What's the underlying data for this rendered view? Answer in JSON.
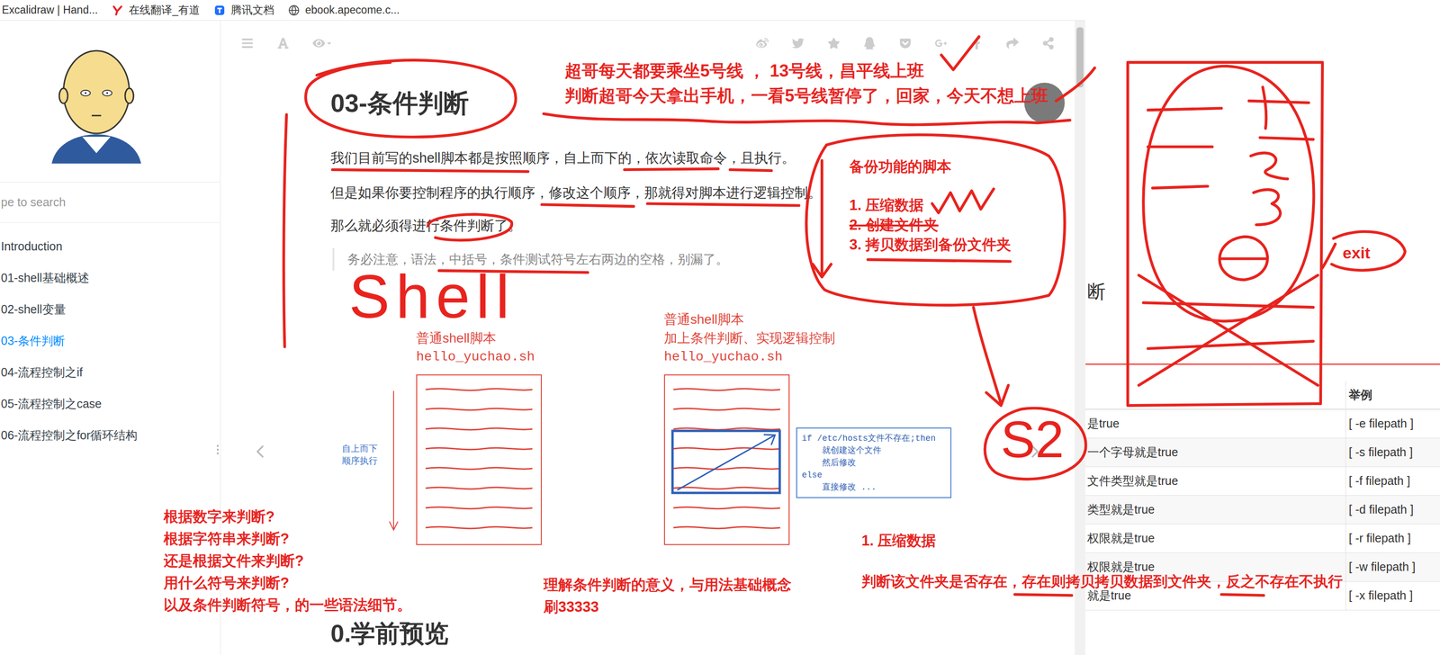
{
  "browser": {
    "bookmarks": [
      {
        "label": "Excalidraw | Hand...",
        "kind": "none"
      },
      {
        "label": "在线翻译_有道",
        "kind": "youdao"
      },
      {
        "label": "腾讯文档",
        "kind": "tencent"
      },
      {
        "label": "ebook.apecome.c...",
        "kind": "globe"
      }
    ]
  },
  "sidebar": {
    "search_placeholder": "pe to search",
    "items": [
      {
        "label": "Introduction",
        "selected": false
      },
      {
        "label": "01-shell基础概述",
        "selected": false
      },
      {
        "label": "02-shell变量",
        "selected": false
      },
      {
        "label": "03-条件判断",
        "selected": true
      },
      {
        "label": "04-流程控制之if",
        "selected": false
      },
      {
        "label": "05-流程控制之case",
        "selected": false
      },
      {
        "label": "06-流程控制之for循环结构",
        "selected": false
      }
    ]
  },
  "page": {
    "title": "03-条件判断",
    "paragraphs": [
      "我们目前写的shell脚本都是按照顺序，自上而下的，依次读取命令，且执行。",
      "但是如果你要控制程序的执行顺序，修改这个顺序，那就得对脚本进行逻辑控制。",
      "那么就必须得进行条件判断了。"
    ],
    "note": "务必注意，语法，中括号，条件测试符号左右两边的空格，别漏了。",
    "figure": {
      "plain": {
        "caption": [
          "普通shell脚本"
        ],
        "file": "hello_yuchao.sh"
      },
      "controlled": {
        "caption": [
          "普通shell脚本",
          "加上条件判断、实现逻辑控制"
        ],
        "file": "hello_yuchao.sh"
      },
      "arrow_label": [
        "自上而下",
        "顺序执行"
      ],
      "code": [
        "if /etc/hosts文件不存在;then",
        "    就创建这个文件",
        "    然后修改",
        "else",
        "    直接修改 ..."
      ]
    },
    "section": "0.学前预览"
  },
  "reference_panel": {
    "heading": "断",
    "columns": [
      "举例"
    ],
    "rows": [
      {
        "condition": "是true",
        "example": "[ -e filepath ]"
      },
      {
        "condition": "一个字母就是true",
        "example": "[ -s filepath ]"
      },
      {
        "condition": "文件类型就是true",
        "example": "[ -f filepath ]"
      },
      {
        "condition": "类型就是true",
        "example": "[ -d filepath ]"
      },
      {
        "condition": "权限就是true",
        "example": "[ -r filepath ]"
      },
      {
        "condition": "权限就是true",
        "example": "[ -w filepath ]"
      },
      {
        "condition": "就是true",
        "example": "[ -x filepath ]"
      }
    ]
  },
  "annotations": {
    "commute": [
      "超哥每天都要乘坐5号线 ， 13号线，昌平线上班",
      "判断超哥今天拿出手机，一看5号线暂停了，回家，今天不想上班"
    ],
    "backup": {
      "title": "备份功能的脚本",
      "steps": [
        {
          "text": "1. 压缩数据",
          "struck": false
        },
        {
          "text": "2. 创建文件夹",
          "struck": true
        },
        {
          "text": "3. 拷贝数据到备份文件夹",
          "struck": false
        }
      ]
    },
    "exit": "exit",
    "shell": "Shell",
    "s2": "S2",
    "questions": [
      "根据数字来判断?",
      "根据字符串来判断?",
      "还是根据文件来判断?",
      "用什么符号来判断?",
      "以及条件判断符号，的一些语法细节。"
    ],
    "summary": [
      "理解条件判断的意义，与用法基础概念",
      "刷33333"
    ],
    "step": "1. 压缩数据",
    "rule": "判断该文件夹是否存在，存在则拷贝拷贝数据到文件夹，反之不存在不执行"
  }
}
